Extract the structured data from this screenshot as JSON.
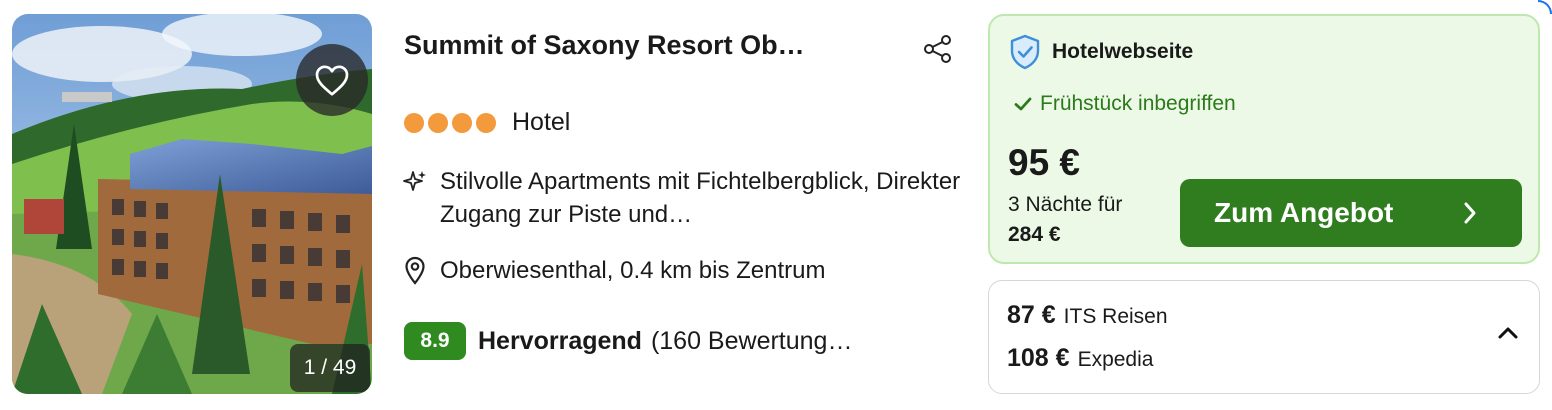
{
  "hotel": {
    "name": "Summit of Saxony Resort Ob…",
    "type": "Hotel",
    "star_count": 4,
    "feature": "Stilvolle Apartments mit Fichtelbergblick, Direkter Zugang zur Piste und…",
    "location": "Oberwiesenthal, 0.4 km bis Zentrum",
    "rating": {
      "score": "8.9",
      "label": "Hervorragend",
      "count_text": "(160 Bewertung…"
    }
  },
  "gallery": {
    "counter": "1 / 49",
    "favorite_icon": "heart-icon"
  },
  "deal": {
    "provider": "Hotelwebseite",
    "provider_icon": "shield-check-icon",
    "breakfast": "Frühstück inbegriffen",
    "price": "95 €",
    "nights_text": "3 Nächte für",
    "total": "284 €",
    "cta_label": "Zum Angebot"
  },
  "other_offers": [
    {
      "price": "87 €",
      "provider": "ITS Reisen"
    },
    {
      "price": "108 €",
      "provider": "Expedia"
    }
  ],
  "colors": {
    "star": "#f39a3c",
    "rating_badge": "#2f8a1f",
    "cta": "#2f7d1e",
    "deal_bg": "#ecf9e6",
    "breakfast_text": "#2c7a1b"
  }
}
